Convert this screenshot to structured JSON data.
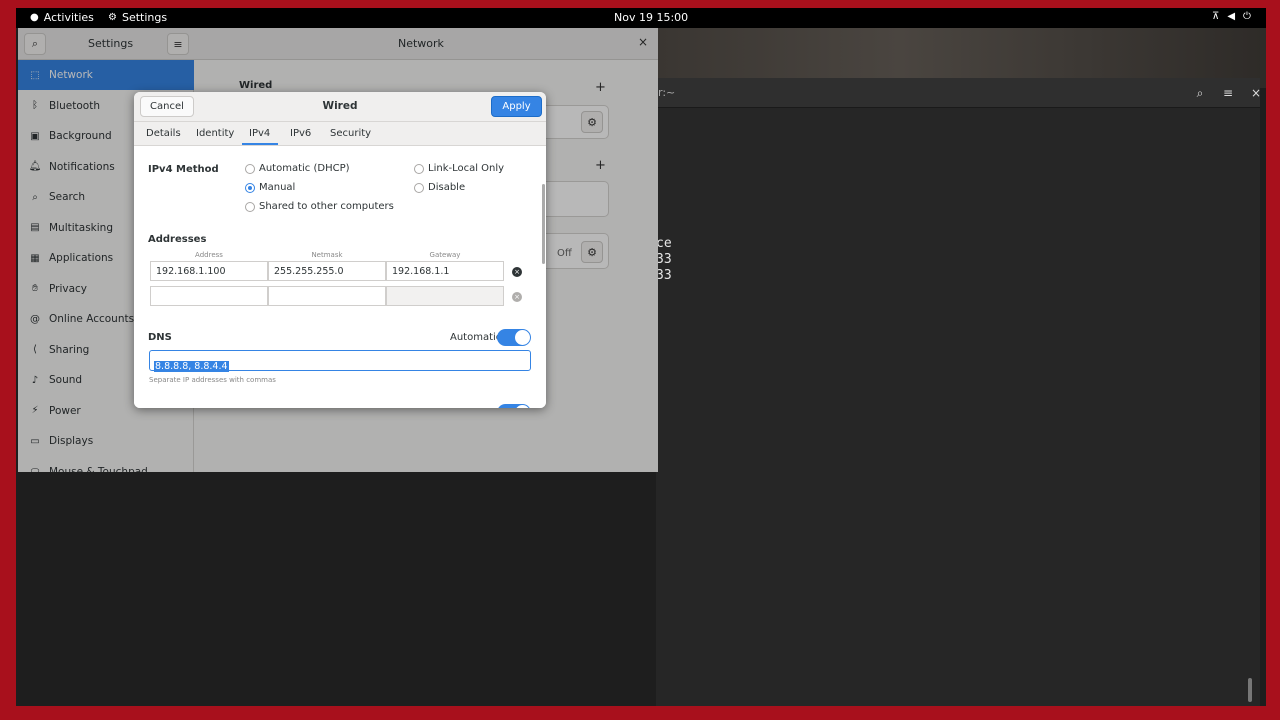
{
  "topbar": {
    "activities": "Activities",
    "app_menu": "Settings",
    "clock": "Nov 19  15:00"
  },
  "settings": {
    "title": "Settings",
    "pane_title": "Network",
    "sidebar": [
      {
        "label": "Network",
        "icon": "network-icon",
        "glyph": "⬚",
        "active": true
      },
      {
        "label": "Bluetooth",
        "icon": "bluetooth-icon",
        "glyph": "ᛒ"
      },
      {
        "label": "Background",
        "icon": "background-icon",
        "glyph": "▣"
      },
      {
        "label": "Notifications",
        "icon": "bell-icon",
        "glyph": "🔔︎"
      },
      {
        "label": "Search",
        "icon": "search-icon",
        "glyph": "⌕"
      },
      {
        "label": "Multitasking",
        "icon": "multitasking-icon",
        "glyph": "▤"
      },
      {
        "label": "Applications",
        "icon": "applications-icon",
        "glyph": "▦"
      },
      {
        "label": "Privacy",
        "icon": "privacy-icon",
        "glyph": "✋︎"
      },
      {
        "label": "Online Accounts",
        "icon": "online-accounts-icon",
        "glyph": "@"
      },
      {
        "label": "Sharing",
        "icon": "sharing-icon",
        "glyph": "⟨"
      },
      {
        "label": "Sound",
        "icon": "sound-icon",
        "glyph": "♪"
      },
      {
        "label": "Power",
        "icon": "power-icon",
        "glyph": "⚡︎"
      },
      {
        "label": "Displays",
        "icon": "displays-icon",
        "glyph": "▭"
      },
      {
        "label": "Mouse & Touchpad",
        "icon": "mouse-icon",
        "glyph": "⬭"
      }
    ],
    "network_pane": {
      "wired_label": "Wired",
      "vpn_off_label": "Off"
    }
  },
  "dialog": {
    "title": "Wired",
    "cancel": "Cancel",
    "apply": "Apply",
    "tabs": [
      "Details",
      "Identity",
      "IPv4",
      "IPv6",
      "Security"
    ],
    "active_tab": "IPv4",
    "ipv4_method_label": "IPv4 Method",
    "methods": {
      "auto": "Automatic (DHCP)",
      "manual": "Manual",
      "shared": "Shared to other computers",
      "link_local": "Link-Local Only",
      "disable": "Disable"
    },
    "selected_method": "Manual",
    "addresses_label": "Addresses",
    "columns": [
      "Address",
      "Netmask",
      "Gateway"
    ],
    "rows": [
      {
        "address": "192.168.1.100",
        "netmask": "255.255.255.0",
        "gateway": "192.168.1.1"
      },
      {
        "address": "",
        "netmask": "",
        "gateway": ""
      }
    ],
    "dns_label": "DNS",
    "dns_automatic_label": "Automatic",
    "dns_automatic": true,
    "dns_value": "8.8.8.8, 8.8.4.4",
    "dns_hint": "Separate IP addresses with commas"
  },
  "terminal": {
    "title": "r:~",
    "lines": [
      "ce",
      "33",
      "33"
    ]
  },
  "colors": {
    "accent": "#3584e4",
    "frame": "#a8101c"
  }
}
